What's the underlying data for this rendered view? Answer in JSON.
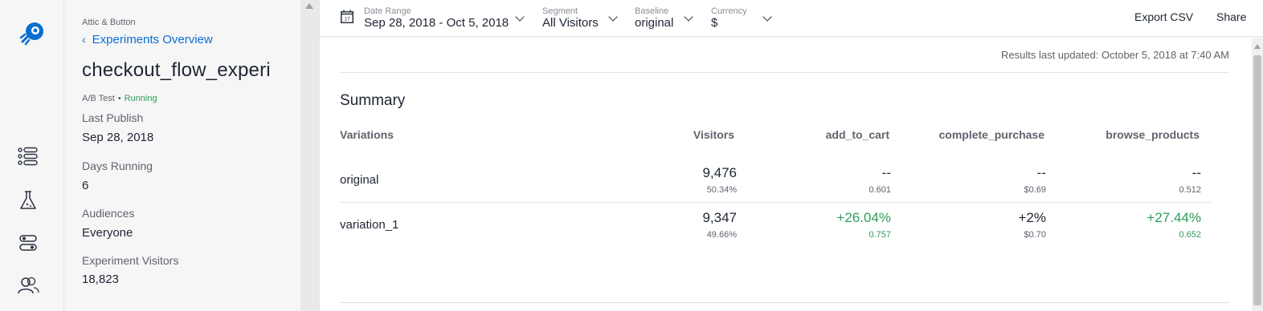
{
  "breadcrumb": {
    "project": "Attic & Button",
    "back_label": "Experiments Overview"
  },
  "experiment": {
    "name": "checkout_flow_experi",
    "type": "A/B Test",
    "separator": "•",
    "status": "Running"
  },
  "meta": [
    {
      "label": "Last Publish",
      "value": "Sep 28, 2018"
    },
    {
      "label": "Days Running",
      "value": "6"
    },
    {
      "label": "Audiences",
      "value": "Everyone"
    },
    {
      "label": "Experiment Visitors",
      "value": "18,823"
    }
  ],
  "rail_icons": [
    "logo-icon",
    "list-icon",
    "flask-icon",
    "toggle-icon",
    "people-icon"
  ],
  "toolbar": {
    "date_range": {
      "label": "Date Range",
      "value": "Sep 28, 2018 - Oct 5, 2018",
      "calendar_day": "17"
    },
    "segment": {
      "label": "Segment",
      "value": "All Visitors"
    },
    "baseline": {
      "label": "Baseline",
      "value": "original"
    },
    "currency": {
      "label": "Currency",
      "value": "$"
    },
    "export_label": "Export CSV",
    "share_label": "Share"
  },
  "results_updated": "Results last updated: October 5, 2018 at 7:40 AM",
  "summary": {
    "title": "Summary",
    "columns": [
      "Variations",
      "Visitors",
      "add_to_cart",
      "complete_purchase",
      "browse_products"
    ],
    "rows": [
      {
        "name": "original",
        "visitors": "9,476",
        "visitors_pct": "50.34%",
        "add_to_cart": {
          "main": "--",
          "sub": "0.601"
        },
        "complete_purchase": {
          "main": "--",
          "sub": "$0.69"
        },
        "browse_products": {
          "main": "--",
          "sub": "0.512"
        }
      },
      {
        "name": "variation_1",
        "visitors": "9,347",
        "visitors_pct": "49.66%",
        "add_to_cart": {
          "main": "+26.04%",
          "sub": "0.757"
        },
        "complete_purchase": {
          "main": "+2%",
          "sub": "$0.70"
        },
        "browse_products": {
          "main": "+27.44%",
          "sub": "0.652"
        }
      }
    ]
  },
  "colors": {
    "accent": "#0a6ed1",
    "positive": "#2e9a5a",
    "text": "#1e2533",
    "muted": "#60636d"
  }
}
